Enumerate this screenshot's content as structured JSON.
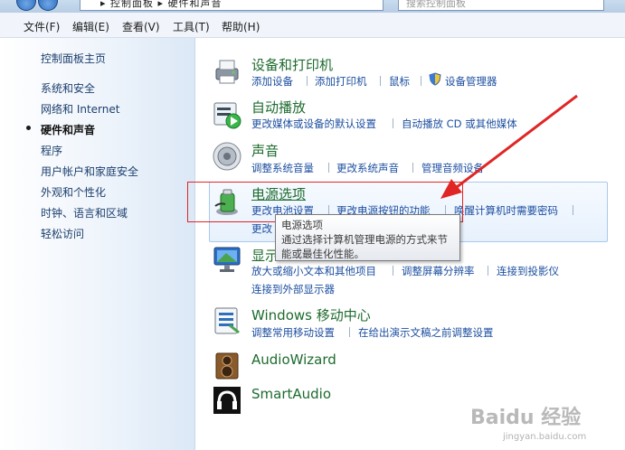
{
  "address_bar": {
    "text": "▸ 控制面板 ▸ 硬件和声音"
  },
  "search": {
    "placeholder": "搜索控制面板"
  },
  "menu": [
    "文件(F)",
    "编辑(E)",
    "查看(V)",
    "工具(T)",
    "帮助(H)"
  ],
  "sidebar": {
    "home": "控制面板主页",
    "items": [
      "系统和安全",
      "网络和 Internet",
      "硬件和声音",
      "程序",
      "用户帐户和家庭安全",
      "外观和个性化",
      "时钟、语言和区域",
      "轻松访问"
    ],
    "current_index": 2
  },
  "categories": {
    "devices": {
      "title": "设备和打印机",
      "links": [
        "添加设备",
        "添加打印机",
        "鼠标",
        "设备管理器"
      ]
    },
    "autoplay": {
      "title": "自动播放",
      "links": [
        "更改媒体或设备的默认设置",
        "自动播放 CD 或其他媒体"
      ]
    },
    "sound": {
      "title": "声音",
      "links": [
        "调整系统音量",
        "更改系统声音",
        "管理音频设备"
      ]
    },
    "power": {
      "title": "电源选项",
      "links": [
        "更改电池设置",
        "更改电源按钮的功能",
        "唤醒计算机时需要密码"
      ],
      "partial": "更改"
    },
    "display": {
      "title": "显示",
      "links": [
        "放大或缩小文本和其他项目",
        "调整屏幕分辨率",
        "连接到投影仪",
        "连接到外部显示器"
      ]
    },
    "mobility": {
      "title": "Windows 移动中心",
      "links": [
        "调整常用移动设置",
        "在给出演示文稿之前调整设置"
      ]
    },
    "audiowizard": {
      "title": "AudioWizard"
    },
    "smartaudio": {
      "title": "SmartAudio"
    }
  },
  "tooltip": {
    "title": "电源选项",
    "body": "通过选择计算机管理电源的方式来节能或最佳化性能。"
  },
  "watermark": {
    "main": "Baidu 经验",
    "sub": "jingyan.baidu.com"
  },
  "colors": {
    "link": "#1d4fa0",
    "category_title": "#1d6b2e",
    "annotation": "#e02525",
    "tooltip_border": "#7a7a7a"
  }
}
